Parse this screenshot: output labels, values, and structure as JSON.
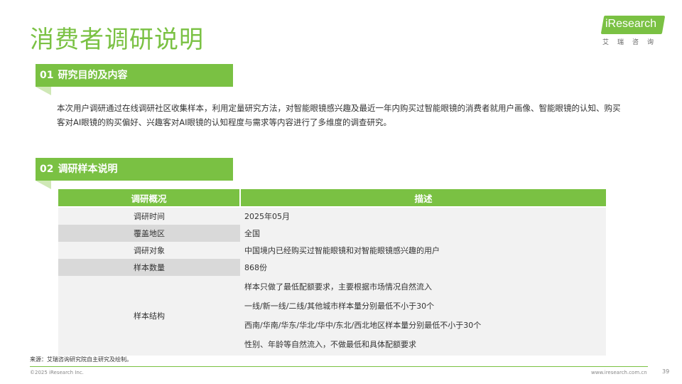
{
  "title": "消费者调研说明",
  "logo": {
    "word": "iResearch",
    "sub": "艾瑞咨询"
  },
  "section1": {
    "num": "01",
    "label": "研究目的及内容",
    "body": "本次用户调研通过在线调研社区收集样本，利用定量研究方法，对智能眼镜感兴趣及最近一年内购买过智能眼镜的消费者就用户画像、智能眼镜的认知、购买客对AI眼镜的购买偏好、兴趣客对AI眼镜的认知程度与需求等内容进行了多维度的调查研究。"
  },
  "section2": {
    "num": "02",
    "label": "调研样本说明"
  },
  "table": {
    "headers": [
      "调研概况",
      "描述"
    ],
    "rows": [
      {
        "key": "调研时间",
        "value": "2025年05月"
      },
      {
        "key": "覆盖地区",
        "value": "全国"
      },
      {
        "key": "调研对象",
        "value": "中国境内已经购买过智能眼镜和对智能眼镜感兴趣的用户"
      },
      {
        "key": "样本数量",
        "value": "868份"
      }
    ],
    "structure": {
      "key": "样本结构",
      "lines": [
        "样本只做了最低配额要求，主要根据市场情况自然流入",
        "一线/新一线/二线/其他城市样本量分别最低不小于30个",
        "西南/华南/华东/华北/华中/东北/西北地区样本量分别最低不小于30个",
        "性别、年龄等自然流入，不做最低和具体配额要求"
      ]
    }
  },
  "footer": {
    "source": "来源：艾瑞咨询研究院自主研究及绘制。",
    "copyright": "©2025 iResearch Inc.",
    "website": "www.iresearch.com.cn",
    "page": "39"
  },
  "colors": {
    "accent": "#7ac143",
    "accent_light": "#cfe8b6",
    "row_dark": "#d9d9d9",
    "row_light": "#f2f2f2"
  }
}
